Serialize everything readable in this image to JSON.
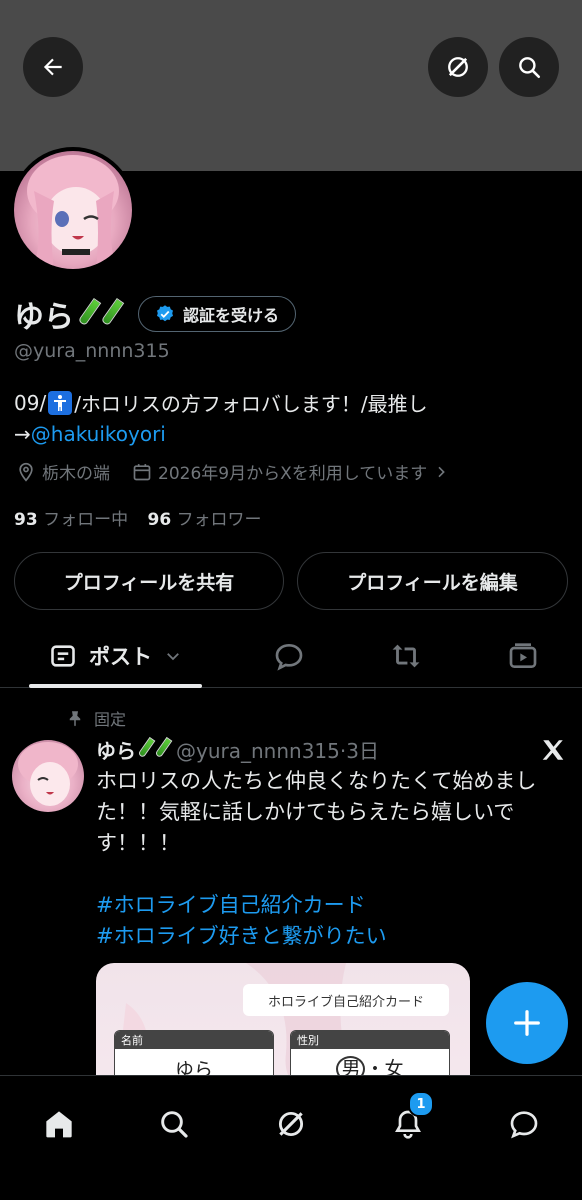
{
  "header": {
    "back_icon": "arrow-left-icon",
    "grok_icon": "grok-icon",
    "search_icon": "search-icon"
  },
  "profile": {
    "display_name": "ゆら",
    "name_emoji": "test-tube-icon",
    "verify_label": "認証を受ける",
    "handle": "@yura_nnnn315",
    "bio_prefix": "09/",
    "bio_accessibility_icon": "accessibility-icon",
    "bio_rest": "/ホロリスの方フォロバします！/最推し",
    "bio_arrow": "→",
    "bio_link": "@hakuikoyori",
    "location": "栃木の端",
    "joined": "2026年9月からXを利用しています",
    "following_count": "93",
    "following_label": "フォロー中",
    "followers_count": "96",
    "followers_label": "フォロワー",
    "share_button": "プロフィールを共有",
    "edit_button": "プロフィールを編集"
  },
  "tabs": {
    "posts_label": "ポスト",
    "items": [
      "posts-icon",
      "replies-icon",
      "reposts-icon",
      "media-icon"
    ]
  },
  "pinned_tweet": {
    "pinned_label": "固定",
    "name": "ゆら",
    "handle_time": "@yura_nnnn315·3日",
    "body_line1": "ホロリスの人たちと仲良くなりたくて始めました！！気軽に話しかけてもらえたら嬉しいです！！！",
    "hashtag1": "#ホロライブ自己紹介カード",
    "hashtag2": "#ホロライブ好きと繋がりたい",
    "card_title": "ホロライブ自己紹介カード",
    "card_name_label": "名前",
    "card_name_value": "ゆら",
    "card_gender_label": "性別",
    "card_gender_male": "男",
    "card_gender_sep": "・",
    "card_gender_female": "女"
  },
  "bottom_nav": {
    "items": [
      "home-icon",
      "search-icon",
      "grok-icon",
      "notifications-icon",
      "messages-icon"
    ],
    "notification_badge": "1"
  },
  "colors": {
    "accent": "#1d9bf0",
    "background": "#000000",
    "text": "#e7e9ea",
    "muted": "#71767b"
  }
}
